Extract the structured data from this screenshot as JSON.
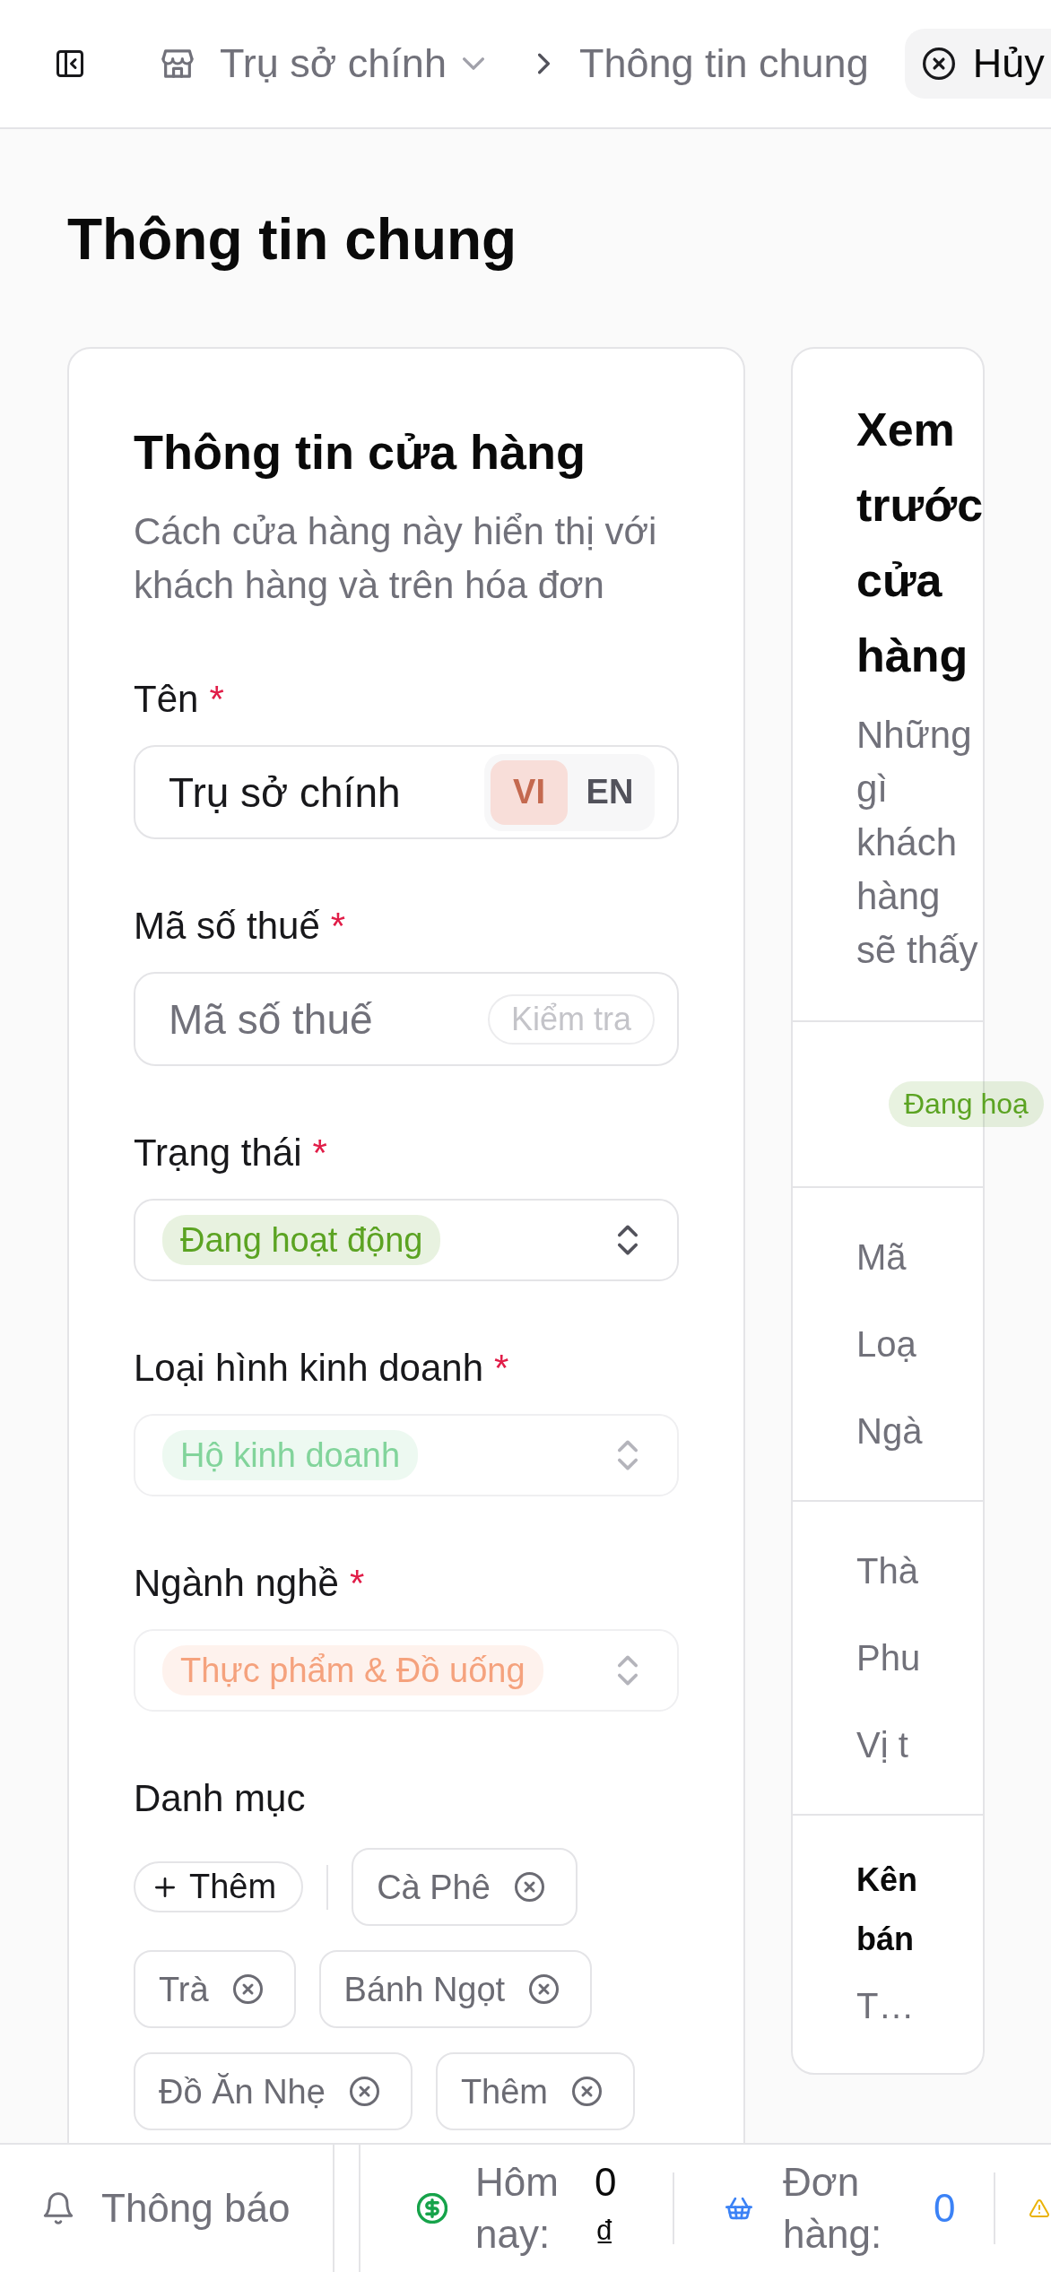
{
  "top_bar": {
    "breadcrumb": [
      {
        "kind": "switcher",
        "label": "Trụ sở chính"
      },
      {
        "kind": "current",
        "label": "Thông tin chung"
      }
    ],
    "cancel_button": "Hủy"
  },
  "page_title": "Thông tin chung",
  "store_info": {
    "title": "Thông tin cửa hàng",
    "subtitle": "Cách cửa hàng này hiển thị với khách hàng và trên hóa đơn",
    "fields": [
      {
        "kind": "text",
        "label": "Tên",
        "required_mark": "*",
        "value": "Trụ sở chính",
        "languages": [
          {
            "label": "VI",
            "selected": true
          },
          {
            "label": "EN",
            "selected": false
          }
        ]
      },
      {
        "kind": "lookup",
        "label": "Mã số thuế",
        "required_mark": "*",
        "placeholder": "Mã số thuế",
        "action": {
          "label": "Kiểm tra",
          "disabled": true
        }
      },
      {
        "kind": "select",
        "label": "Trạng thái",
        "required_mark": "*",
        "disabled": false,
        "tag": {
          "label": "Đang hoạt động",
          "color": "#5ba322"
        }
      },
      {
        "kind": "select",
        "label": "Loại hình kinh doanh",
        "required_mark": "*",
        "disabled": true,
        "tag": {
          "label": "Hộ kinh doanh",
          "color": "#82d49b"
        }
      },
      {
        "kind": "select",
        "label": "Ngành nghề",
        "required_mark": "*",
        "disabled": true,
        "tag": {
          "label": "Thực phẩm & Đồ uống",
          "color": "#f5a27d"
        }
      },
      {
        "kind": "categories",
        "label": "Danh mục",
        "add_button": "Thêm",
        "items": [
          "Cà Phê",
          "Trà",
          "Bánh Ngọt",
          "Đồ Ăn Nhẹ",
          "Thêm"
        ]
      }
    ]
  },
  "preview": {
    "title": "Xem trước cửa hàng",
    "subtitle": "Những gì khách hàng sẽ thấy",
    "status_tag": {
      "label": "Đang hoạ",
      "color": "#5ba322"
    },
    "detail_groups": [
      [
        "Mã",
        "Loạ",
        "Ngà"
      ],
      [
        "Thà",
        "Phu",
        "Vị t"
      ]
    ],
    "last_section": {
      "heading": "Kên bán",
      "value": "T…"
    }
  },
  "bottom_bar": {
    "notifications": "Thông báo",
    "stats": [
      {
        "kind": "revenue",
        "label": "Hôm nay:",
        "value": "0 ₫"
      },
      {
        "kind": "orders",
        "label": "Đơn hàng:",
        "value": "0"
      },
      {
        "kind": "alerts"
      }
    ]
  }
}
